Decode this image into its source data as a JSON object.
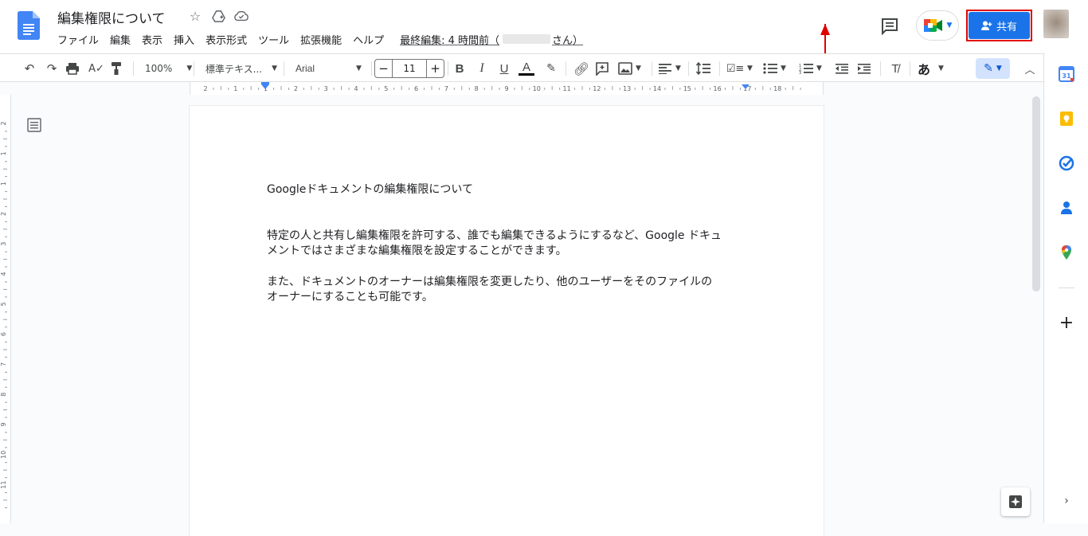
{
  "document": {
    "title": "編集権限について"
  },
  "menus": [
    "ファイル",
    "編集",
    "表示",
    "挿入",
    "表示形式",
    "ツール",
    "拡張機能",
    "ヘルプ"
  ],
  "last_edit": {
    "prefix": "最終編集: 4 時間前（",
    "suffix": "さん）"
  },
  "share": {
    "label": "共有"
  },
  "toolbar": {
    "zoom": "100%",
    "style": "標準テキス...",
    "font": "Arial",
    "font_size": "11",
    "input_tool": "あ"
  },
  "ruler": {
    "labels": [
      "2",
      "1",
      "1",
      "2",
      "3",
      "4",
      "5",
      "6",
      "7",
      "8",
      "9",
      "10",
      "11",
      "12",
      "13",
      "14",
      "15",
      "16",
      "17",
      "18"
    ],
    "vlabels": [
      "2",
      "1",
      "1",
      "2",
      "3",
      "4",
      "5",
      "6",
      "7",
      "8",
      "9",
      "10",
      "11"
    ]
  },
  "content": {
    "heading": "Googleドキュメントの編集権限について",
    "para1_line1": "特定の人と共有し編集権限を許可する、誰でも編集できるようにするなど、Google ドキュ",
    "para1_line2": "メントではさまざまな編集権限を設定することができます。",
    "para2_line1": "また、ドキュメントのオーナーは編集権限を変更したり、他のユーザーをそのファイルの",
    "para2_line2": "オーナーにすることも可能です。"
  },
  "colors": {
    "share_bg": "#1a73e8",
    "highlight_border": "#e00000",
    "annotation_arrow": "#e00000"
  },
  "icons": {
    "star": "star-icon",
    "drive": "move-to-drive-icon",
    "cloud": "cloud-saved-icon"
  }
}
